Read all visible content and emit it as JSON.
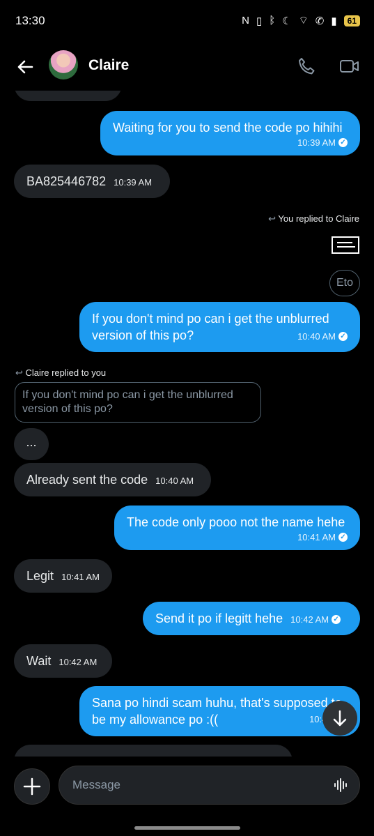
{
  "status_bar": {
    "time": "13:30",
    "battery": "61"
  },
  "header": {
    "contact_name": "Claire"
  },
  "messages": {
    "m1": {
      "text": "Waiting for you to send the code po hihihi",
      "time": "10:39 AM"
    },
    "m2": {
      "text": "BA825446782",
      "time": "10:39 AM"
    },
    "reply1_label": "You replied to Claire",
    "m3": {
      "text": "Eto"
    },
    "m4": {
      "line1": "If you don't mind po can i get the unblurred",
      "line2": "version of this po?",
      "time": "10:40 AM"
    },
    "reply2_label": "Claire replied to you",
    "quote": {
      "line1": "If you don't mind po can i get the unblurred",
      "line2": "version of this po?"
    },
    "m5": {
      "text": "..."
    },
    "m6": {
      "text": "Already sent the code",
      "time": "10:40 AM"
    },
    "m7": {
      "text": "The code only pooo not the name hehe",
      "time": "10:41 AM"
    },
    "m8": {
      "text": "Legit",
      "time": "10:41 AM"
    },
    "m9": {
      "text": "Send it po if legitt hehe",
      "time": "10:42 AM"
    },
    "m10": {
      "text": "Wait",
      "time": "10:42 AM"
    },
    "m11": {
      "line1": "Sana po hindi scam huhu, that's supposed to",
      "line2": "be my allowance po :((",
      "time": "10:43 AM"
    }
  },
  "composer": {
    "placeholder": "Message"
  },
  "colors": {
    "accent": "#1d9bf0",
    "incoming": "#202327",
    "background": "#000000"
  }
}
